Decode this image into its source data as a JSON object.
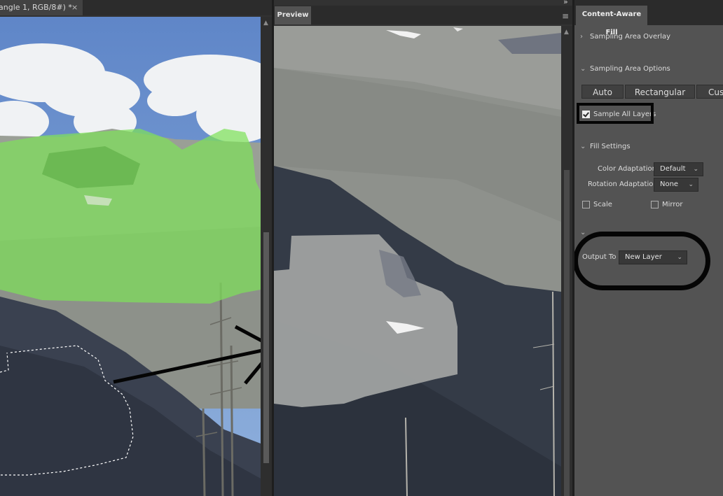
{
  "document": {
    "tab_title": "angle 1, RGB/8#) *",
    "close_glyph": "×"
  },
  "preview": {
    "tab_label": "Preview",
    "menu_icon": "hamburger-menu-icon",
    "collapse_glyph": "»"
  },
  "panel": {
    "tab_label": "Content-Aware Fill",
    "sampling_overlay": {
      "label": "Sampling Area Overlay",
      "expanded": false
    },
    "sampling_options": {
      "label": "Sampling Area Options",
      "expanded": true,
      "modes": [
        "Auto",
        "Rectangular",
        "Cust"
      ],
      "sample_all_layers": {
        "label": "Sample All Layers",
        "checked": true
      }
    },
    "fill_settings": {
      "label": "Fill Settings",
      "color_adaptation": {
        "label": "Color Adaptation",
        "value": "Default"
      },
      "rotation_adaptation": {
        "label": "Rotation Adaptation",
        "value": "None"
      },
      "scale": {
        "label": "Scale",
        "checked": false
      },
      "mirror": {
        "label": "Mirror",
        "checked": false
      }
    },
    "output": {
      "label": "Output To",
      "value": "New Layer"
    }
  },
  "colors": {
    "panel_bg": "#535353",
    "tab_bar": "#2b2b2b",
    "selection_overlay": "#7ee05a",
    "annotation": "#050505"
  }
}
